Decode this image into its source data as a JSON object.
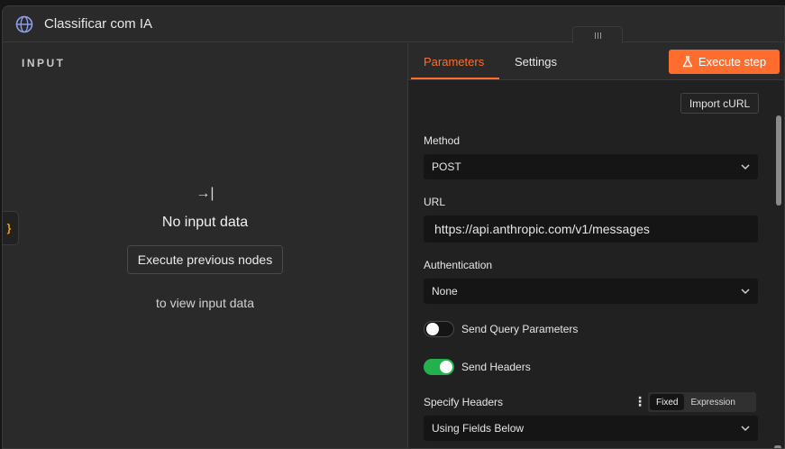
{
  "window": {
    "title": "Classificar com IA"
  },
  "input_pane": {
    "label": "INPUT",
    "arrow": "→|",
    "empty_message": "No input data",
    "execute_prev_label": "Execute previous nodes",
    "sub_message": "to view input data",
    "bracket": "}"
  },
  "tabs": {
    "parameters": "Parameters",
    "settings": "Settings"
  },
  "execute_step_label": "Execute step",
  "import_curl_label": "Import cURL",
  "method": {
    "label": "Method",
    "value": "POST"
  },
  "url": {
    "label": "URL",
    "value": "https://api.anthropic.com/v1/messages"
  },
  "authentication": {
    "label": "Authentication",
    "value": "None"
  },
  "send_query": {
    "label": "Send Query Parameters",
    "enabled": false
  },
  "send_headers": {
    "label": "Send Headers",
    "enabled": true
  },
  "specify_headers": {
    "label": "Specify Headers",
    "dots": "⋮",
    "modes": [
      "Fixed",
      "Expression"
    ],
    "active_mode": "Fixed",
    "value": "Using Fields Below"
  },
  "colors": {
    "accent": "#ff6d2e",
    "toggle_on": "#22b14c",
    "bracket": "#f0a020"
  },
  "icons": {
    "title": "globe-icon",
    "execute": "flask-icon",
    "select": "chevron-down-icon"
  }
}
